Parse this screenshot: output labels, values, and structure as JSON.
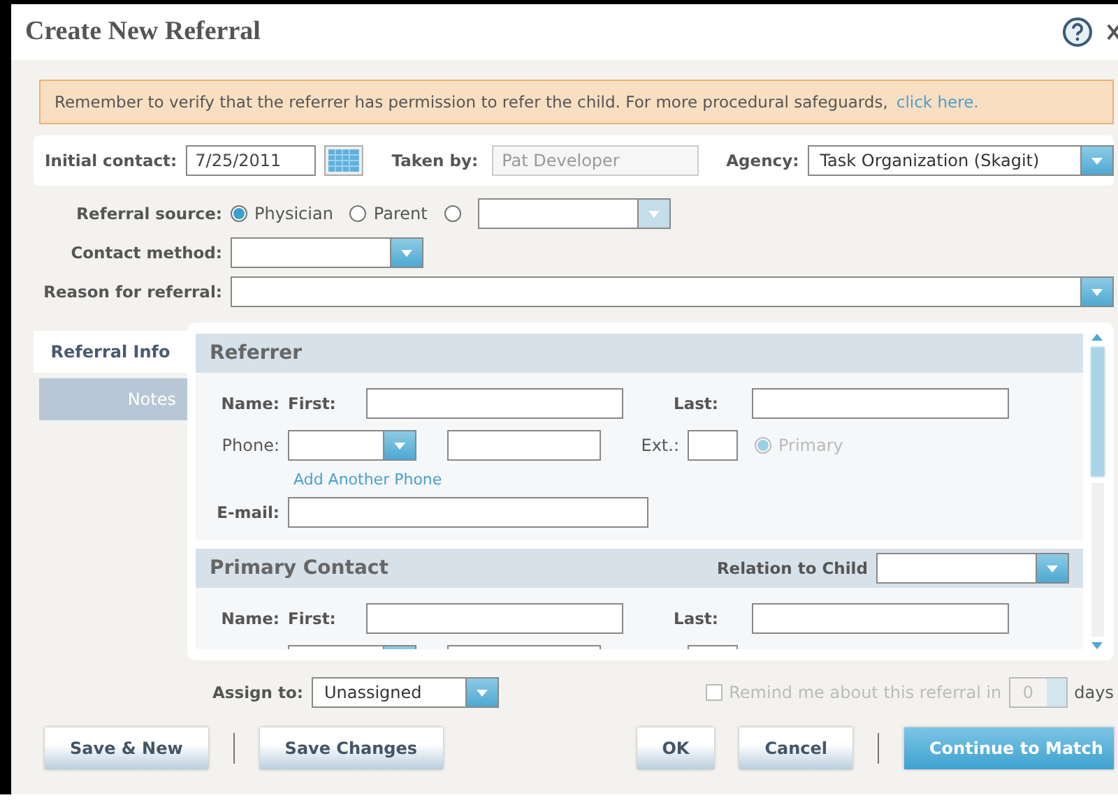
{
  "window": {
    "title": "Create New Referral"
  },
  "notice": {
    "text": "Remember to verify that the referrer has permission to refer the child. For more procedural safeguards,",
    "link": "click here."
  },
  "initial_contact": {
    "label": "Initial contact:",
    "value": "7/25/2011"
  },
  "taken_by": {
    "label": "Taken by:",
    "value": "Pat Developer",
    "disabled": true
  },
  "agency": {
    "label": "Agency:",
    "value": "Task Organization (Skagit)"
  },
  "referral_source": {
    "label": "Referral source:",
    "options": [
      {
        "label": "Physician",
        "selected": true
      },
      {
        "label": "Parent",
        "selected": false
      },
      {
        "selected": false
      }
    ]
  },
  "contact_method": {
    "label": "Contact method:"
  },
  "reason": {
    "label": "Reason for referral:"
  },
  "tabs": [
    {
      "label": "Referral Info",
      "selected": true
    },
    {
      "label": "Notes",
      "selected": false
    }
  ],
  "referrer": {
    "title": "Referrer",
    "name_label": "Name:",
    "first_label": "First:",
    "last_label": "Last:",
    "phone_label": "Phone:",
    "ext_label": "Ext.:",
    "primary": {
      "label": "Primary",
      "selected": true,
      "disabled": true
    },
    "add_phone": "Add Another Phone",
    "email_label": "E-mail:"
  },
  "primary_contact": {
    "title": "Primary Contact",
    "relation_label": "Relation to Child",
    "name_label": "Name:",
    "first_label": "First:",
    "last_label": "Last:"
  },
  "assign": {
    "label": "Assign to:",
    "value": "Unassigned"
  },
  "remind": {
    "label": "Remind me about this referral in",
    "checked": false,
    "disabled": true,
    "value": "0",
    "unit": "days"
  },
  "buttons_left": [
    {
      "label": "Save & New",
      "kind": "default"
    },
    {
      "label": "Save Changes",
      "kind": "default"
    }
  ],
  "buttons_right": [
    {
      "label": "OK",
      "kind": "default"
    },
    {
      "label": "Cancel",
      "kind": "default"
    },
    {
      "label": "Continue to Match",
      "kind": "primary"
    }
  ]
}
